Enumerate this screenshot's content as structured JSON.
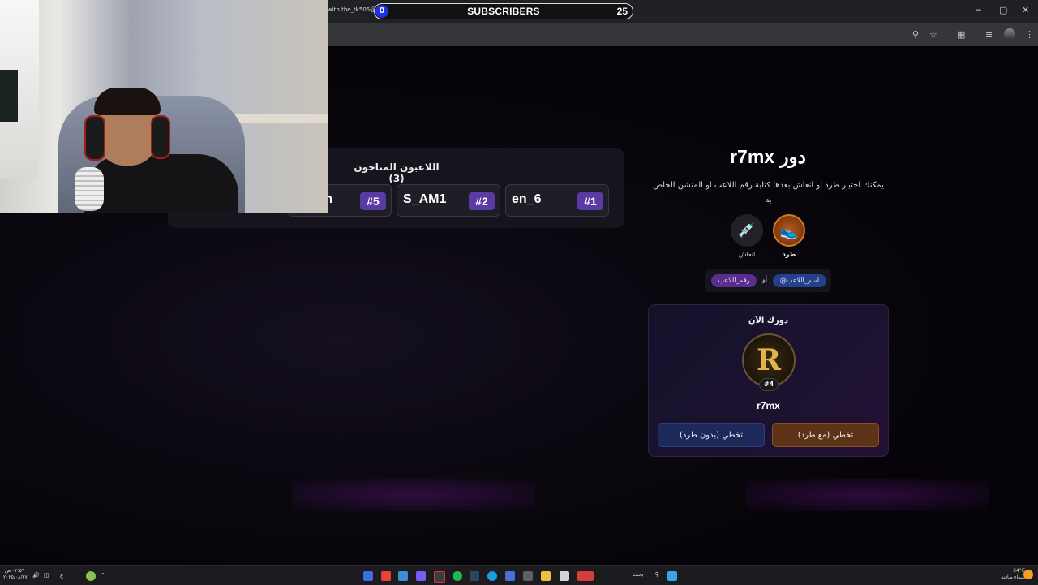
{
  "browser": {
    "tab_title": "with the_tk505@ …",
    "new_tab_glyph": "+",
    "window_controls": [
      "─",
      "▢",
      "✕"
    ]
  },
  "subscribers_widget": {
    "current": "0",
    "label": "SUBSCRIBERS",
    "goal": "25"
  },
  "players_panel": {
    "title": "اللاعبون المتاحون (3)",
    "players": [
      {
        "name": "en_6",
        "number": "#1"
      },
      {
        "name": "S_AM1",
        "number": "#2"
      },
      {
        "name": "lomvn",
        "number": "#5"
      }
    ]
  },
  "turn": {
    "title": "دور r7mx",
    "description": "يمكنك اختيار طرد او انعاش بعدها كتابة رقم اللاعب او المنشن الخاص به",
    "actions": [
      {
        "label": "طرد",
        "icon": "sneaker-icon"
      },
      {
        "label": "انعاش",
        "icon": "syringe-icon"
      }
    ],
    "chip_name": "@اسم_اللاعب",
    "chip_or": "أو",
    "chip_number": "رقم_اللاعب",
    "card": {
      "title": "دورك الآن",
      "avatar_letter": "R",
      "badge": "#4",
      "player_name": "r7mx",
      "skip_with_kick": "تخطي (مع طرد)",
      "skip_without_kick": "تخطي (بدون طرد)"
    }
  },
  "taskbar": {
    "search_label": "بحث",
    "clock_time": "٠٢:٥٩ ص",
    "clock_date": "٢٠٢٥/٠٨/٢٧",
    "weather_temp": "34°C",
    "weather_desc": "سماء صافية",
    "lang": "ع"
  },
  "colors": {
    "accent_purple": "#5a3aa3",
    "kick_orange": "#d9781f",
    "skip_blue": "#1b2a5a",
    "subscriber_blue": "#1f30e6"
  }
}
